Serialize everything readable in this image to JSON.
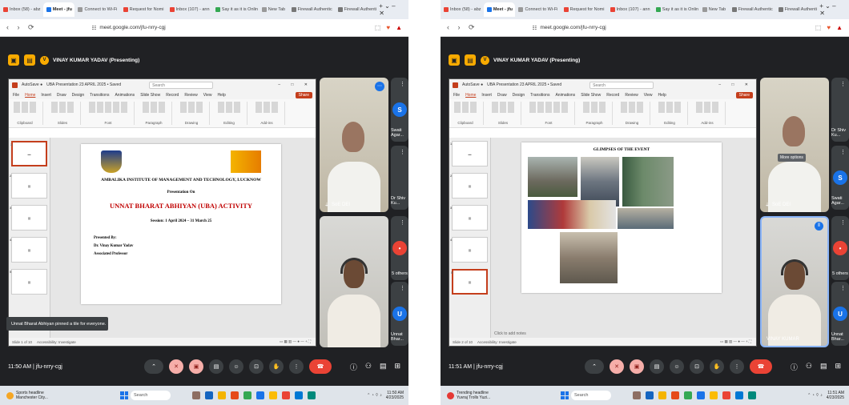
{
  "left": {
    "tabs": [
      {
        "label": "Inbox (58) - abz",
        "color": "#ea4335",
        "active": false
      },
      {
        "label": "Meet - jfu",
        "color": "#1a73e8",
        "active": true
      },
      {
        "label": "Connect to Wi-Fi",
        "color": "#999999",
        "active": false
      },
      {
        "label": "Request for Nomi",
        "color": "#ea4335",
        "active": false
      },
      {
        "label": "Inbox (107) - ann",
        "color": "#ea4335",
        "active": false
      },
      {
        "label": "Say it as it is Onlin",
        "color": "#34a853",
        "active": false
      },
      {
        "label": "New Tab",
        "color": "#999999",
        "active": false
      },
      {
        "label": "Firewall Authentic",
        "color": "#777777",
        "active": false
      },
      {
        "label": "Firewall Authenti",
        "color": "#777777",
        "active": false
      }
    ],
    "url": "meet.google.com/jfu-nrry-cgj",
    "presenter": "VINAY KUMAR YADAV (Presenting)",
    "ppt_title": "UBA Presentation 23 APRIL 2025 • Saved",
    "ppt_search": "Search",
    "ppt_menu": [
      "File",
      "Home",
      "Insert",
      "Draw",
      "Design",
      "Transitions",
      "Animations",
      "Slide Show",
      "Record",
      "Review",
      "View",
      "Help"
    ],
    "ppt_share": "Share",
    "ribbon_groups": [
      "Clipboard",
      "Slides",
      "Font",
      "Paragraph",
      "Drawing",
      "Editing",
      "Add-ins"
    ],
    "slide_institute": "AMBALIKA INSTITUTE OF MANAGEMENT AND TECHNOLOGY, LUCKNOW",
    "slide_presentation_on": "Presentation On",
    "slide_heading": "UNNAT BHARAT ABHIYAN (UBA) ACTIVITY",
    "slide_session": "Session: 1 April 2024 – 31 March 25",
    "slide_presented_by": "Presented By:",
    "slide_presenter_name": "Dr. Vinay Kumar Yadav",
    "slide_presenter_role": "Associated Professor",
    "toast": "Unnat Bharat Abhiyan pinned a tile for everyone.",
    "status": "Slide 1 of 10",
    "accessibility": "Accessibility: Investigate",
    "tile1_name": "SoE DEI",
    "side": [
      {
        "label": "Swati Agar...",
        "initial": "S",
        "color": "#1a73e8"
      },
      {
        "label": "Dr Shiv Ku...",
        "initial": "",
        "color": "#3c4043"
      },
      {
        "label": "5 others",
        "initial": "•",
        "color": "#ea4335"
      },
      {
        "label": "Unnat Bhar...",
        "initial": "U",
        "color": "#1a73e8"
      }
    ],
    "meeting_info": "11:50 AM | jfu-nrry-cgj",
    "weather_title": "Sports headline",
    "weather_sub": "Manchester City...",
    "search_box": "Search",
    "clock_time": "11:50 AM",
    "clock_date": "4/23/2025"
  },
  "right": {
    "tabs": [
      {
        "label": "Inbox (58) - abz",
        "color": "#ea4335",
        "active": false
      },
      {
        "label": "Meet - jfu",
        "color": "#1a73e8",
        "active": true
      },
      {
        "label": "Connect to Wi-Fi",
        "color": "#999999",
        "active": false
      },
      {
        "label": "Request for Nomi",
        "color": "#ea4335",
        "active": false
      },
      {
        "label": "Inbox (107) - ann",
        "color": "#ea4335",
        "active": false
      },
      {
        "label": "Say it as it is Onlin",
        "color": "#34a853",
        "active": false
      },
      {
        "label": "New Tab",
        "color": "#999999",
        "active": false
      },
      {
        "label": "Firewall Authentic",
        "color": "#777777",
        "active": false
      },
      {
        "label": "Firewall Authenti",
        "color": "#777777",
        "active": false
      }
    ],
    "url": "meet.google.com/jfu-nrry-cgj",
    "presenter": "VINAY KUMAR YADAV (Presenting)",
    "ppt_title": "UBA Presentation 23 APRIL 2025 • Saved",
    "ppt_search": "Search",
    "ppt_menu": [
      "File",
      "Home",
      "Insert",
      "Draw",
      "Design",
      "Transitions",
      "Animations",
      "Slide Show",
      "Record",
      "Review",
      "View",
      "Help"
    ],
    "ppt_share": "Share",
    "ribbon_groups": [
      "Clipboard",
      "Slides",
      "Font",
      "Paragraph",
      "Drawing",
      "Editing",
      "Add-ins"
    ],
    "slide_heading": "GLIMPSES OF THE EVENT",
    "notes": "Click to add notes",
    "status": "Slide 2 of 10",
    "accessibility": "Accessibility: Investigate",
    "tile1_name": "SoE DEI",
    "tile1_tooltip": "More options",
    "tile2_name": "VINAY KUMAR",
    "side": [
      {
        "label": "Dr Shiv Ku...",
        "initial": "",
        "color": "#3c4043"
      },
      {
        "label": "Swati Agar...",
        "initial": "S",
        "color": "#1a73e8"
      },
      {
        "label": "5 others",
        "initial": "•",
        "color": "#ea4335"
      },
      {
        "label": "Unnat Bhar...",
        "initial": "U",
        "color": "#1a73e8"
      }
    ],
    "meeting_info": "11:51 AM | jfu-nrry-cgj",
    "weather_title": "Trending headline",
    "weather_sub": "Yuvraj Trolls Yuzi...",
    "search_box": "Search",
    "clock_time": "11:51 AM",
    "clock_date": "4/23/2025"
  }
}
